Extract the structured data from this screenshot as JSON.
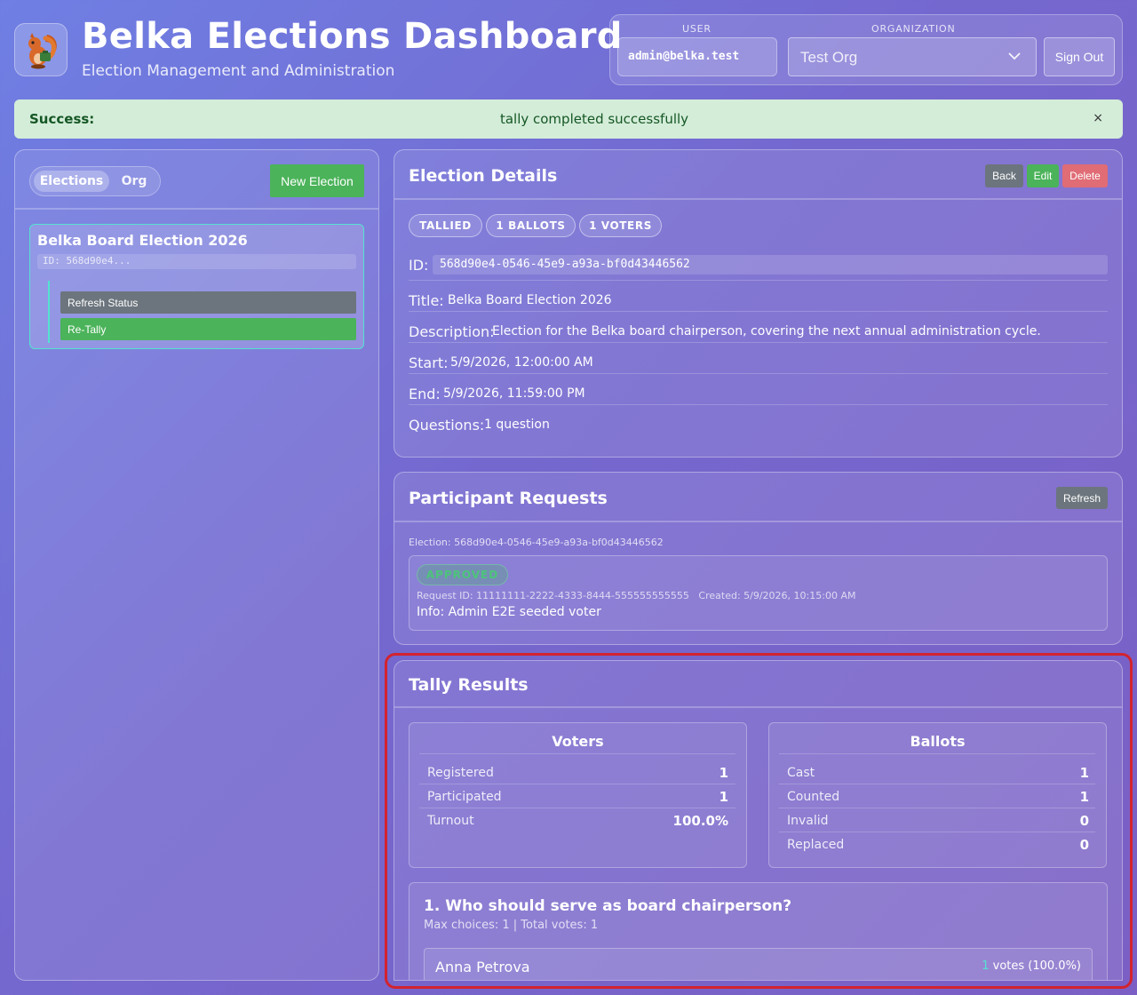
{
  "header": {
    "title": "Belka Elections Dashboard",
    "subtitle": "Election Management and Administration",
    "user_label": "USER",
    "user_value": "admin@belka.test",
    "org_label": "ORGANIZATION",
    "org_value": "Test Org",
    "sign_out": "Sign Out"
  },
  "alert": {
    "label": "Success:",
    "message": "tally completed successfully",
    "close": "×"
  },
  "sidebar": {
    "tabs": [
      "Elections",
      "Org"
    ],
    "new_election": "New Election",
    "election": {
      "title": "Belka Board Election 2026",
      "id": "ID: 568d90e4...",
      "refresh": "Refresh Status",
      "retally": "Re-Tally"
    }
  },
  "details": {
    "title": "Election Details",
    "buttons": {
      "back": "Back",
      "edit": "Edit",
      "delete": "Delete"
    },
    "pills": [
      "TALLIED",
      "1 BALLOTS",
      "1 VOTERS"
    ],
    "id_label": "ID:",
    "id_value": "568d90e4-0546-45e9-a93a-bf0d43446562",
    "title_label": "Title:",
    "title_value": "Belka Board Election 2026",
    "description_label": "Description:",
    "description_value": "Election for the Belka board chairperson, covering the next annual administration cycle.",
    "start_label": "Start:",
    "start_value": "5/9/2026, 12:00:00 AM",
    "end_label": "End:",
    "end_value": "5/9/2026, 11:59:00 PM",
    "questions_label": "Questions:",
    "questions_value": "1 question"
  },
  "requests": {
    "title": "Participant Requests",
    "refresh": "Refresh",
    "election_line": "Election: 568d90e4-0546-45e9-a93a-bf0d43446562",
    "status": "APPROVED",
    "meta": "Request ID: 11111111-2222-4333-8444-555555555555   Created: 5/9/2026, 10:15:00 AM",
    "info": "Info: Admin E2E seeded voter"
  },
  "tally": {
    "title": "Tally Results",
    "voters": {
      "title": "Voters",
      "rows": [
        {
          "k": "Registered",
          "v": "1"
        },
        {
          "k": "Participated",
          "v": "1"
        },
        {
          "k": "Turnout",
          "v": "100.0%"
        }
      ]
    },
    "ballots": {
      "title": "Ballots",
      "rows": [
        {
          "k": "Cast",
          "v": "1"
        },
        {
          "k": "Counted",
          "v": "1"
        },
        {
          "k": "Invalid",
          "v": "0"
        },
        {
          "k": "Replaced",
          "v": "0"
        }
      ]
    },
    "question": {
      "title": "1. Who should serve as board chairperson?",
      "meta": "Max choices: 1 | Total votes: 1",
      "candidate": "Anna Petrova",
      "votes_count": "1",
      "votes_rest": " votes (100.0%)"
    }
  },
  "colors": {
    "success_green": "#4bb35a",
    "danger_red": "#e06c75",
    "grey": "#6c757d",
    "accent_teal": "#55e2d0",
    "focus_red": "#d3232e"
  }
}
